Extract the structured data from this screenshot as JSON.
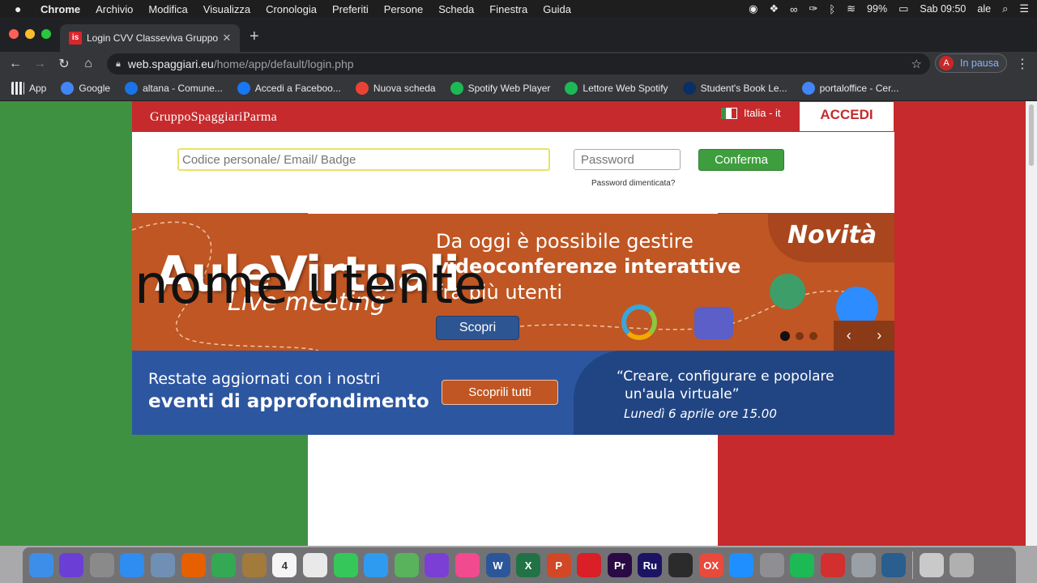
{
  "menubar": {
    "items": [
      "Chrome",
      "Archivio",
      "Modifica",
      "Visualizza",
      "Cronologia",
      "Preferiti",
      "Persone",
      "Scheda",
      "Finestra",
      "Guida"
    ],
    "battery": "99%",
    "clock": "Sab 09:50",
    "user": "ale"
  },
  "tab": {
    "favicon_text": "is",
    "title": "Login CVV Classeviva Gruppo S"
  },
  "omnibox": {
    "host": "web.spaggiari.eu",
    "path": "/home/app/default/login.php"
  },
  "profile": {
    "initial": "A",
    "status": "In pausa"
  },
  "bookmarks": [
    {
      "label": "App",
      "color": "#e8eaed",
      "icon": "apps-grid-icon"
    },
    {
      "label": "Google",
      "color": "#4285f4",
      "icon": "google-icon"
    },
    {
      "label": "altana - Comune...",
      "color": "#1a73e8",
      "icon": "altana-icon"
    },
    {
      "label": "Accedi a Faceboo...",
      "color": "#1877f2",
      "icon": "facebook-icon"
    },
    {
      "label": "Nuova scheda",
      "color": "#ea4335",
      "icon": "gmail-icon"
    },
    {
      "label": "Spotify Web Player",
      "color": "#1db954",
      "icon": "spotify-icon"
    },
    {
      "label": "Lettore Web Spotify",
      "color": "#1db954",
      "icon": "spotify-icon"
    },
    {
      "label": "Student's Book Le...",
      "color": "#0a2f63",
      "icon": "oxford-icon"
    },
    {
      "label": "portaloffice - Cer...",
      "color": "#4285f4",
      "icon": "google-icon"
    }
  ],
  "site": {
    "brand": "GruppoSpaggiariParma",
    "language": "Italia - it",
    "login_tab": "ACCEDI",
    "user_placeholder": "Codice personale/ Email/ Badge",
    "password_placeholder": "Password",
    "confirm_label": "Conferma",
    "forgot_label": "Password dimenticata?"
  },
  "banner1": {
    "logo": "AuleVirtuali",
    "logo_sub": "Live meeting",
    "line1": "Da oggi è possibile gestire",
    "line2": "videoconferenze interattive",
    "line3": "fra più utenti",
    "badge": "Novità",
    "button": "Scopri",
    "prev": "‹",
    "next": "›"
  },
  "overlay_text": "nome utente",
  "banner2": {
    "line1": "Restate aggiornati con i nostri",
    "line2": "eventi di approfondimento",
    "button": "Scoprili tutti",
    "quote1": "“Creare, configurare e popolare",
    "quote2": "un'aula virtuale”",
    "date": "Lunedì 6 aprile ore 15.00"
  },
  "dock": [
    {
      "name": "finder-icon",
      "color": "#3d8ee8",
      "text": ""
    },
    {
      "name": "siri-icon",
      "color": "#6b3fd6",
      "text": ""
    },
    {
      "name": "launchpad-icon",
      "color": "#8a8a8a",
      "text": ""
    },
    {
      "name": "safari-icon",
      "color": "#2f8cf0",
      "text": ""
    },
    {
      "name": "preview-icon",
      "color": "#6f8fb4",
      "text": ""
    },
    {
      "name": "firefox-icon",
      "color": "#e66000",
      "text": ""
    },
    {
      "name": "chrome-icon",
      "color": "#34a853",
      "text": ""
    },
    {
      "name": "notes-app-icon",
      "color": "#a27a3c",
      "text": ""
    },
    {
      "name": "calendar-icon",
      "color": "#f5f5f5",
      "text": "4"
    },
    {
      "name": "reminders-icon",
      "color": "#e9e9e9",
      "text": ""
    },
    {
      "name": "facetime-icon",
      "color": "#35c759",
      "text": ""
    },
    {
      "name": "messages-icon",
      "color": "#2f9bf0",
      "text": ""
    },
    {
      "name": "maps-icon",
      "color": "#58b35c",
      "text": ""
    },
    {
      "name": "imovie-icon",
      "color": "#7b3fd6",
      "text": ""
    },
    {
      "name": "itunes-icon",
      "color": "#f24a8e",
      "text": ""
    },
    {
      "name": "word-icon",
      "color": "#2b579a",
      "text": "W"
    },
    {
      "name": "excel-icon",
      "color": "#217346",
      "text": "X"
    },
    {
      "name": "powerpoint-icon",
      "color": "#d24726",
      "text": "P"
    },
    {
      "name": "creative-cloud-icon",
      "color": "#da1f26",
      "text": ""
    },
    {
      "name": "premiere-icon",
      "color": "#2a0a44",
      "text": "Pr"
    },
    {
      "name": "rush-icon",
      "color": "#1b1464",
      "text": "Ru"
    },
    {
      "name": "acrobat-icon",
      "color": "#2b2b2b",
      "text": ""
    },
    {
      "name": "oxford-icon",
      "color": "#e84a3c",
      "text": "OX"
    },
    {
      "name": "app-store-icon",
      "color": "#1f8fff",
      "text": ""
    },
    {
      "name": "system-preferences-icon",
      "color": "#8e8e93",
      "text": ""
    },
    {
      "name": "spotify-icon",
      "color": "#1db954",
      "text": ""
    },
    {
      "name": "antivirus-icon",
      "color": "#d32f2f",
      "text": ""
    },
    {
      "name": "keychain-icon",
      "color": "#9aa0a6",
      "text": ""
    },
    {
      "name": "quicktime-icon",
      "color": "#2a5e8e",
      "text": ""
    },
    {
      "name": "downloads-stack-icon",
      "color": "#c9c9c9",
      "text": ""
    },
    {
      "name": "trash-icon",
      "color": "#b0b0b0",
      "text": ""
    }
  ]
}
